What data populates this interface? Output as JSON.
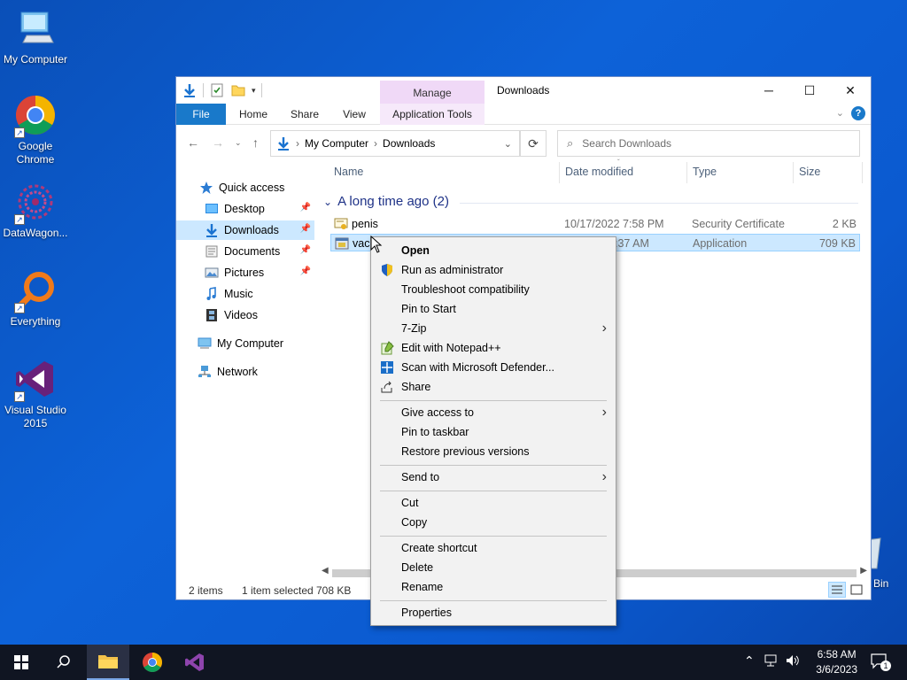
{
  "desktop": {
    "icons": [
      {
        "label": "My Computer"
      },
      {
        "label": "Google Chrome"
      },
      {
        "label": "DataWagon..."
      },
      {
        "label": "Everything"
      },
      {
        "label": "Visual Studio 2015"
      }
    ],
    "recycle_bin_partial": "Bin"
  },
  "window": {
    "title": "Downloads",
    "manage_tab": "Manage",
    "ribbon_tabs": [
      "File",
      "Home",
      "Share",
      "View",
      "Application Tools"
    ],
    "address": {
      "crumbs": [
        "My Computer",
        "Downloads"
      ]
    },
    "search_placeholder": "Search Downloads",
    "nav": {
      "quick_access": "Quick access",
      "items": [
        "Desktop",
        "Downloads",
        "Documents",
        "Pictures",
        "Music",
        "Videos"
      ],
      "my_computer": "My Computer",
      "network": "Network"
    },
    "columns": {
      "name": "Name",
      "date": "Date modified",
      "type": "Type",
      "size": "Size"
    },
    "group": "A long time ago (2)",
    "files": [
      {
        "name": "penis",
        "date": "10/17/2022 7:58 PM",
        "type": "Security Certificate",
        "size": "2 KB"
      },
      {
        "name": "vac",
        "date": ":37 AM",
        "type": "Application",
        "size": "709 KB"
      }
    ],
    "status": {
      "items": "2 items",
      "selected": "1 item selected",
      "size": "708 KB"
    }
  },
  "context_menu": {
    "items": [
      {
        "label": "Open"
      },
      {
        "label": "Run as administrator"
      },
      {
        "label": "Troubleshoot compatibility"
      },
      {
        "label": "Pin to Start"
      },
      {
        "label": "7-Zip"
      },
      {
        "label": "Edit with Notepad++"
      },
      {
        "label": "Scan with Microsoft Defender..."
      },
      {
        "label": "Share"
      },
      {
        "label": "Give access to"
      },
      {
        "label": "Pin to taskbar"
      },
      {
        "label": "Restore previous versions"
      },
      {
        "label": "Send to"
      },
      {
        "label": "Cut"
      },
      {
        "label": "Copy"
      },
      {
        "label": "Create shortcut"
      },
      {
        "label": "Delete"
      },
      {
        "label": "Rename"
      },
      {
        "label": "Properties"
      }
    ]
  },
  "taskbar": {
    "time": "6:58 AM",
    "date": "3/6/2023",
    "notification_count": "1"
  }
}
